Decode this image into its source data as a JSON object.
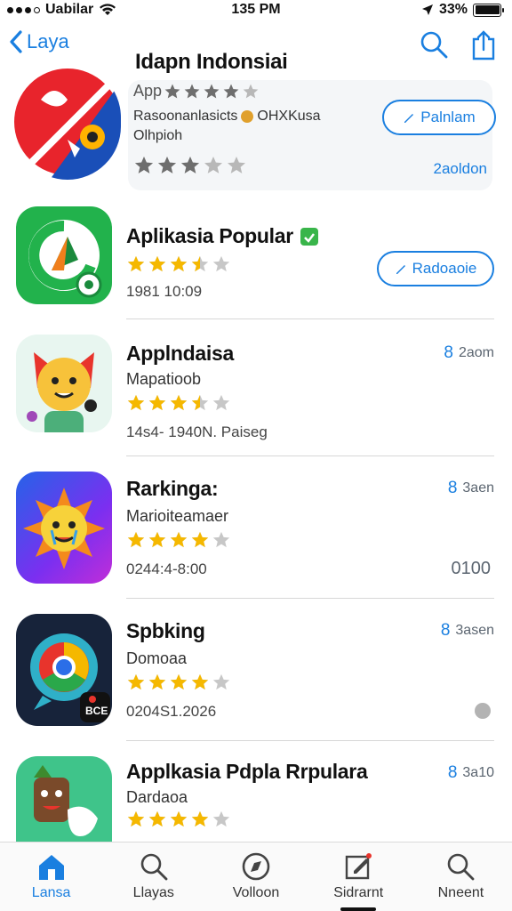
{
  "status_bar": {
    "carrier": "Uabilar",
    "time": "135 PM",
    "battery": "33%"
  },
  "nav": {
    "back_label": "Laya"
  },
  "featured": {
    "title": "Idapn Indonsiai",
    "subtitle": "App",
    "description_line1": "Rasoonanlasicts",
    "description_line1b": "OHXKusa",
    "description_line2": "Olhpioh",
    "rating": 3,
    "action_label": "Palnlam",
    "size": "2aoldon"
  },
  "apps": [
    {
      "title": "Aplikasia Popular",
      "verified": true,
      "subtitle": "",
      "rating": 3.5,
      "meta": "1981 10:09",
      "action_label": "Radoaoie",
      "size": ""
    },
    {
      "title": "Applndaisa",
      "subtitle": "Mapatioob",
      "rating": 3.5,
      "meta": "14s4- 1940N. Paiseg",
      "size": "2aom",
      "size_prefix": "8"
    },
    {
      "title": "Rarkinga:",
      "subtitle": "Marioiteamaer",
      "rating": 4,
      "meta": "0244:4-8:00",
      "size": "3aen",
      "size_prefix": "8",
      "right_number": "0100"
    },
    {
      "title": "Spbking",
      "subtitle": "Domoaa",
      "rating": 4,
      "meta": "0204S1.2026",
      "size": "3asen",
      "size_prefix": "8",
      "icon_badge": "BCE"
    },
    {
      "title": "Applkasia Pdpla Rrpulara",
      "subtitle": "Dardaoa",
      "rating": 4,
      "meta": "",
      "size": "3a10",
      "size_prefix": "8"
    }
  ],
  "tabs": [
    {
      "label": "Lansa",
      "icon": "home-icon",
      "active": true
    },
    {
      "label": "Llayas",
      "icon": "search-icon",
      "active": false
    },
    {
      "label": "Volloon",
      "icon": "compass-icon",
      "active": false
    },
    {
      "label": "Sidrarnt",
      "icon": "edit-icon",
      "active": false
    },
    {
      "label": "Nneent",
      "icon": "search-icon",
      "active": false
    }
  ],
  "colors": {
    "accent": "#1a7fe0",
    "star": "#f5b800",
    "star_empty": "#c7c7c7"
  }
}
